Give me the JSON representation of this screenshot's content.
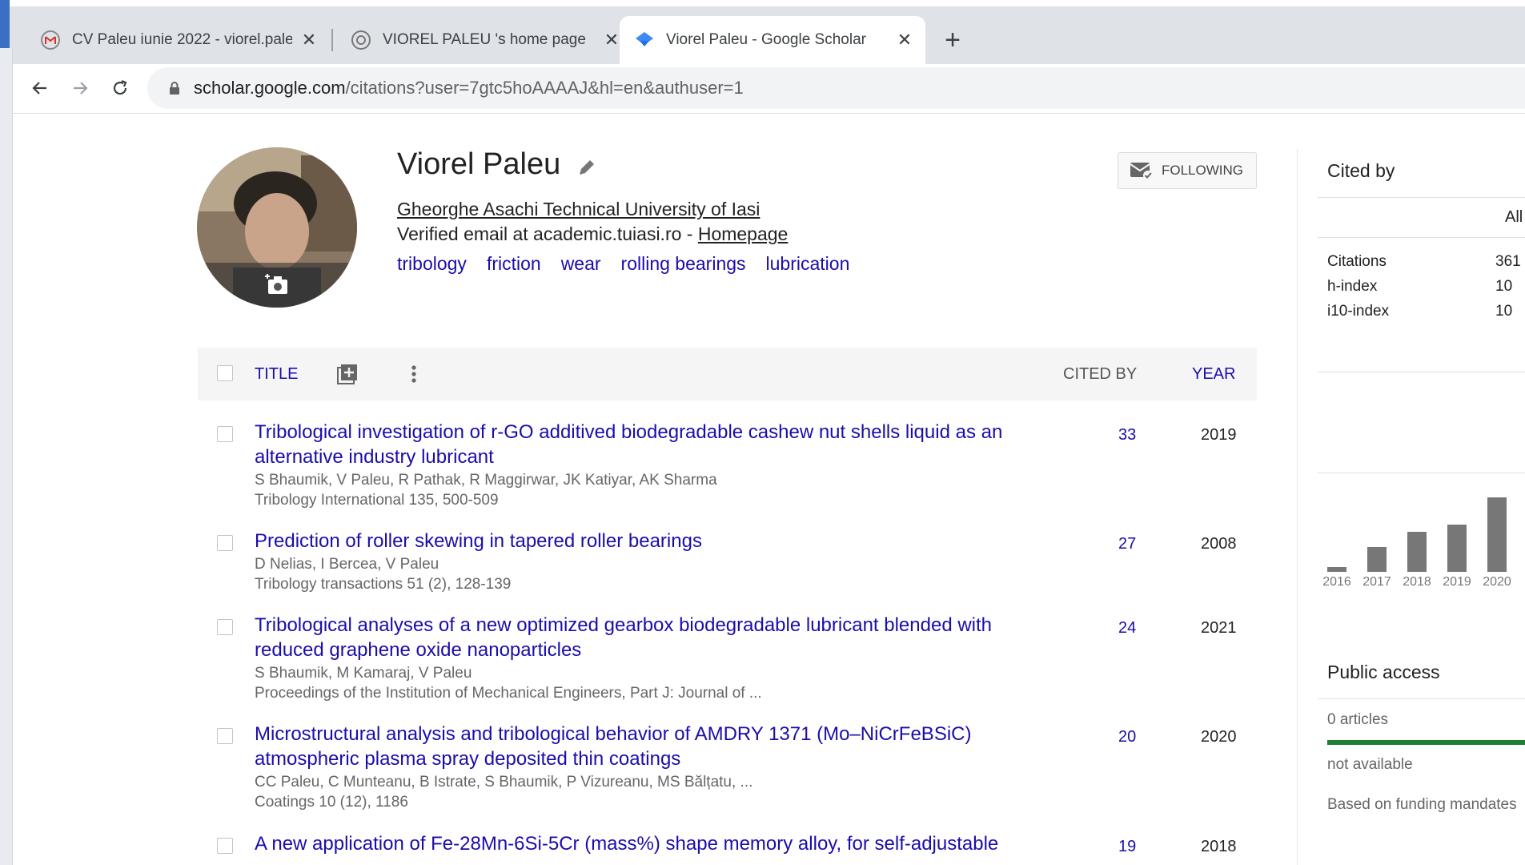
{
  "browser": {
    "tabs": [
      {
        "title": "CV Paleu iunie 2022 - viorel.pale",
        "favicon": "gmail-icon",
        "active": false
      },
      {
        "title": "VIOREL PALEU 's home page",
        "favicon": "globe-icon",
        "active": false
      },
      {
        "title": "Viorel Paleu - Google Scholar",
        "favicon": "scholar-icon",
        "active": true
      }
    ],
    "new_tab": "+",
    "close_glyph": "✕",
    "url_host": "scholar.google.com",
    "url_path": "/citations?user=7gtc5hoAAAAJ&hl=en&authuser=1"
  },
  "profile": {
    "name": "Viorel Paleu",
    "affiliation": "Gheorghe Asachi Technical University of Iasi",
    "email_text": "Verified email at academic.tuiasi.ro - ",
    "homepage_label": "Homepage",
    "interests": [
      "tribology",
      "friction",
      "wear",
      "rolling bearings",
      "lubrication"
    ],
    "follow_label": "FOLLOWING"
  },
  "table": {
    "title_header": "TITLE",
    "cited_header": "CITED BY",
    "year_header": "YEAR",
    "rows": [
      {
        "title": "Tribological investigation of r-GO additived biodegradable cashew nut shells liquid as an alternative industry lubricant",
        "authors": "S Bhaumik, V Paleu, R Pathak, R Maggirwar, JK Katiyar, AK Sharma",
        "venue": "Tribology International 135, 500-509",
        "cited": "33",
        "year": "2019"
      },
      {
        "title": "Prediction of roller skewing in tapered roller bearings",
        "authors": "D Nelias, I Bercea, V Paleu",
        "venue": "Tribology transactions 51 (2), 128-139",
        "cited": "27",
        "year": "2008"
      },
      {
        "title": "Tribological analyses of a new optimized gearbox biodegradable lubricant blended with reduced graphene oxide nanoparticles",
        "authors": "S Bhaumik, M Kamaraj, V Paleu",
        "venue": "Proceedings of the Institution of Mechanical Engineers, Part J: Journal of ...",
        "cited": "24",
        "year": "2021"
      },
      {
        "title": "Microstructural analysis and tribological behavior of AMDRY 1371 (Mo–NiCrFeBSiC) atmospheric plasma spray deposited thin coatings",
        "authors": "CC Paleu, C Munteanu, B Istrate, S Bhaumik, P Vizureanu, MS Bălțatu, ...",
        "venue": "Coatings 10 (12), 1186",
        "cited": "20",
        "year": "2020"
      },
      {
        "title": "A new application of Fe-28Mn-6Si-5Cr (mass%) shape memory alloy, for self-adjustable",
        "authors": "",
        "venue": "",
        "cited": "19",
        "year": "2018"
      }
    ]
  },
  "sidebar": {
    "cited_by_heading": "Cited by",
    "all_label": "All",
    "stats": [
      {
        "label": "Citations",
        "value": "361"
      },
      {
        "label": "h-index",
        "value": "10"
      },
      {
        "label": "i10-index",
        "value": "10"
      }
    ],
    "public_access_heading": "Public access",
    "articles_label": "0 articles",
    "not_available_label": "not available",
    "funding_label": "Based on funding mandates"
  },
  "chart_data": {
    "type": "bar",
    "categories": [
      "2016",
      "2017",
      "2018",
      "2019",
      "2020"
    ],
    "values": [
      5,
      25,
      40,
      47,
      74
    ],
    "ylim": [
      0,
      80
    ],
    "bar_color": "#777777"
  }
}
